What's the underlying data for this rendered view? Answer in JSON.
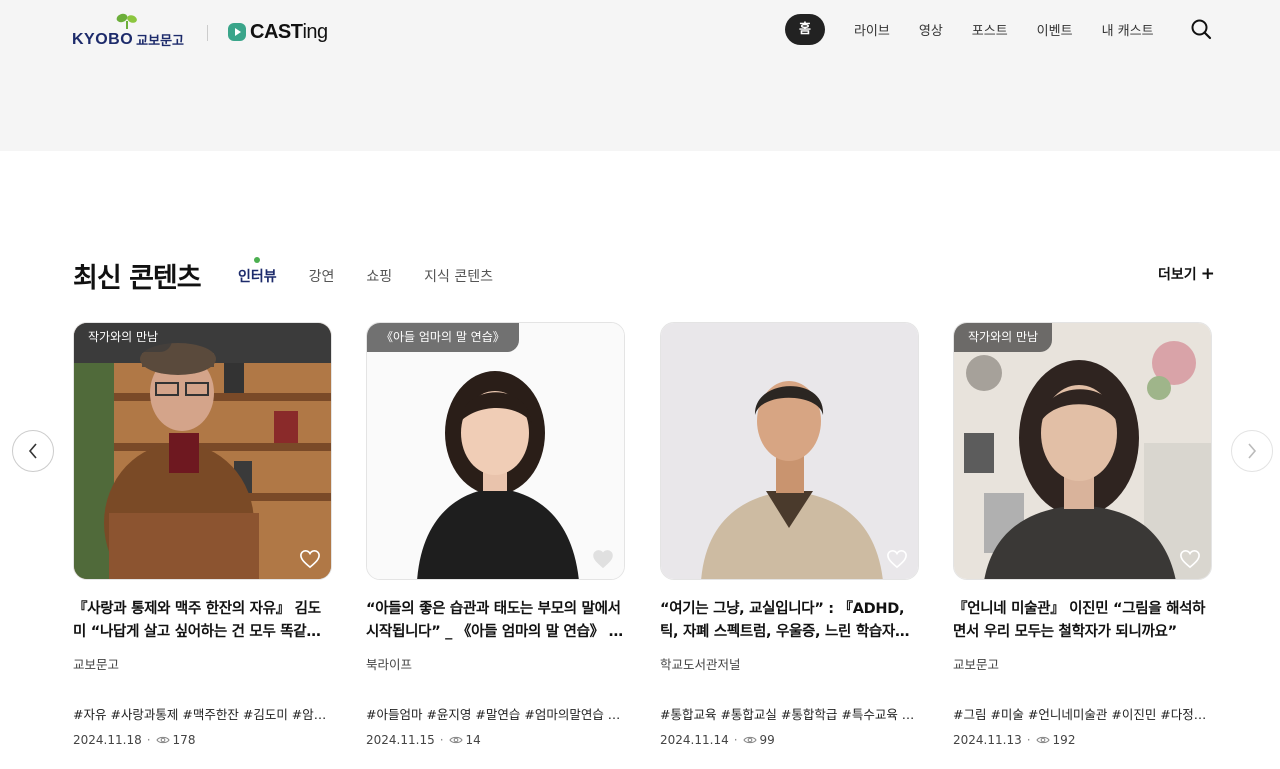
{
  "header": {
    "kyobo_logo_text": "KYOBO",
    "kyobo_logo_kr": "교보문고",
    "casting_logo_cast": "CAST",
    "casting_logo_ing": "ing",
    "nav": [
      {
        "label": "홈",
        "active": true
      },
      {
        "label": "라이브"
      },
      {
        "label": "영상"
      },
      {
        "label": "포스트"
      },
      {
        "label": "이벤트"
      },
      {
        "label": "내 캐스트"
      }
    ]
  },
  "section": {
    "title": "최신 콘텐츠",
    "tabs": [
      "인터뷰",
      "강연",
      "쇼핑",
      "지식 콘텐츠"
    ],
    "active_tab": "인터뷰",
    "more_label": "더보기"
  },
  "cards": [
    {
      "badge": "작가와의 만남",
      "title": "『사랑과 통제와 맥주 한잔의 자유』 김도미 “나답게 살고 싶어하는 건 모두 똑같…",
      "source": "교보문고",
      "tags": "#자유 #사랑과통제 #맥주한잔 #김도미 #암경…",
      "date": "2024.11.18",
      "views": "178"
    },
    {
      "badge": "《아들 엄마의 말 연습》",
      "title": "“아들의 좋은 습관과 태도는 부모의 말에서 시작됩니다” _ 《아들 엄마의 말 연습》 …",
      "source": "북라이프",
      "tags": "#아들엄마 #윤지영 #말연습 #엄마의말연습 #…",
      "date": "2024.11.15",
      "views": "14"
    },
    {
      "badge": "",
      "title": "“여기는 그냥, 교실입니다” : 『ADHD, 틱, 자폐 스펙트럼, 우울증, 느린 학습자도 함…",
      "source": "학교도서관저널",
      "tags": "#통합교육 #통합교실 #통합학급 #특수교육 #…",
      "date": "2024.11.14",
      "views": "99"
    },
    {
      "badge": "작가와의 만남",
      "title": "『언니네 미술관』 이진민 “그림을 해석하면서 우리 모두는 철학자가 되니까요”",
      "source": "교보문고",
      "tags": "#그림 #미술 #언니네미술관 #이진민 #다정한…",
      "date": "2024.11.13",
      "views": "192"
    }
  ],
  "colors": {
    "header_bg": "#f5f5f5",
    "brand_navy": "#1d2b6b",
    "brand_green": "#4caf50",
    "active_nav_bg": "#222222"
  }
}
